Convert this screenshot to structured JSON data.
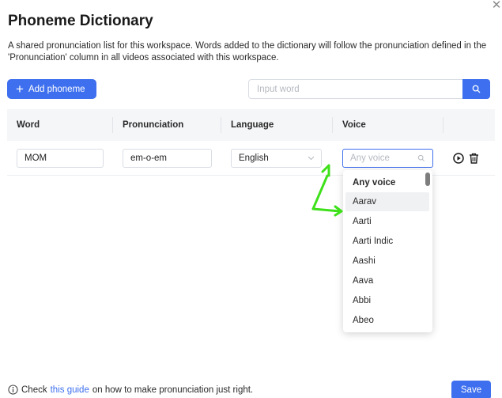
{
  "dialog": {
    "title": "Phoneme Dictionary",
    "description": "A shared pronunciation list for this workspace. Words added to the dictionary will follow the pronunciation defined in the 'Pronunciation' column in all videos associated with this workspace.",
    "close_icon": "close-icon"
  },
  "toolbar": {
    "add_label": "Add phoneme",
    "search_placeholder": "Input word",
    "search_value": ""
  },
  "table": {
    "headers": [
      "Word",
      "Pronunciation",
      "Language",
      "Voice"
    ],
    "row": {
      "word": "MOM",
      "pronunciation": "em-o-em",
      "language": "English",
      "voice_placeholder": "Any voice"
    }
  },
  "voice_dropdown": {
    "options": [
      "Any voice",
      "Aarav",
      "Aarti",
      "Aarti Indic",
      "Aashi",
      "Aava",
      "Abbi",
      "Abeo"
    ],
    "selected": "Any voice",
    "hovered": "Aarav"
  },
  "footer": {
    "text_before": "Check",
    "link_text": "this guide",
    "text_after": "on how to make pronunciation just right.",
    "save_label": "Save"
  },
  "colors": {
    "accent": "#3d6fee",
    "annotation_arrow": "#3ee01a"
  }
}
